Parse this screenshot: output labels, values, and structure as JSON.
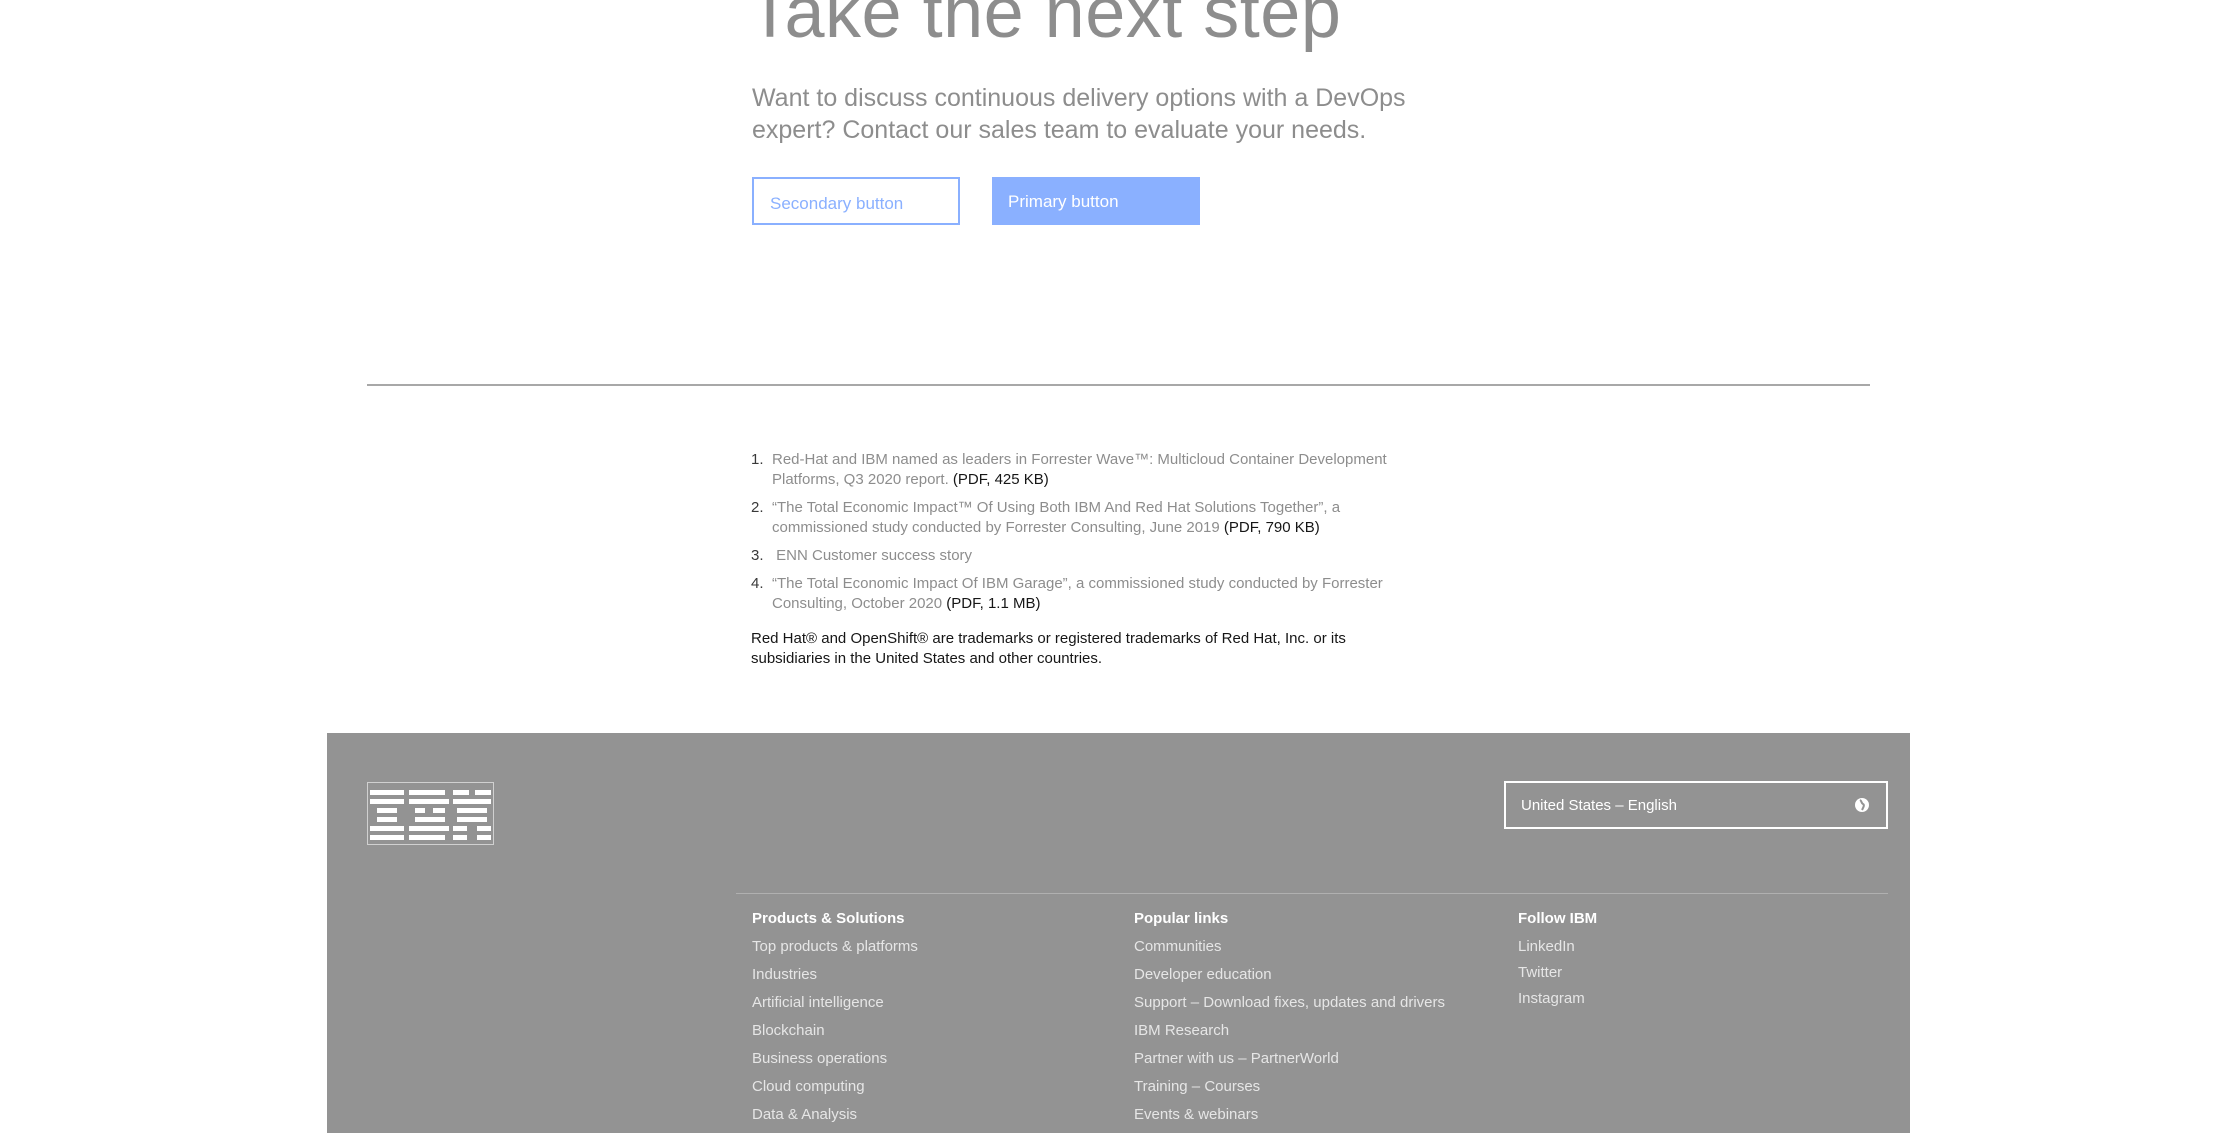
{
  "cta": {
    "title": "Take the next step",
    "lead": "Want to discuss continuous delivery options with a DevOps expert? Contact our sales team to evaluate your needs.",
    "secondary_label": "Secondary button",
    "primary_label": "Primary button"
  },
  "references": [
    {
      "num": "1.",
      "text": "Red-Hat and IBM named as leaders in Forrester Wave™: Multicloud Container Development Platforms, Q3 2020 report.",
      "meta": "(PDF, 425 KB)"
    },
    {
      "num": "2.",
      "text": "“The Total Economic Impact™ Of Using Both IBM And Red Hat Solutions Together”, a commissioned study conducted by Forrester Consulting, June 2019",
      "meta": "(PDF, 790 KB)"
    },
    {
      "num": "3.",
      "text": " ENN Customer success story",
      "meta": ""
    },
    {
      "num": "4.",
      "text": "“The Total Economic Impact Of IBM Garage”, a commissioned study conducted by Forrester Consulting, October 2020",
      "meta": "(PDF, 1.1 MB)"
    }
  ],
  "trademark": "Red Hat® and OpenShift® are trademarks or registered trademarks of Red Hat, Inc. or its subsidiaries in the United States and other countries.",
  "footer": {
    "logo": "IBM",
    "locale": "United States – English",
    "columns": [
      {
        "heading": "Products & Solutions",
        "links": [
          "Top products & platforms",
          "Industries",
          "Artificial intelligence",
          "Blockchain",
          "Business operations",
          "Cloud computing",
          "Data & Analysis"
        ]
      },
      {
        "heading": "Popular links",
        "links": [
          "Communities",
          "Developer education",
          "Support – Download fixes, updates and drivers",
          "IBM Research",
          "Partner with us – PartnerWorld",
          "Training – Courses",
          "Events & webinars"
        ]
      },
      {
        "heading": "Follow IBM",
        "links": [
          "LinkedIn",
          "Twitter",
          "Instagram"
        ]
      }
    ]
  },
  "colors": {
    "accent": "#8ab0ff",
    "footer_bg": "#939393"
  }
}
